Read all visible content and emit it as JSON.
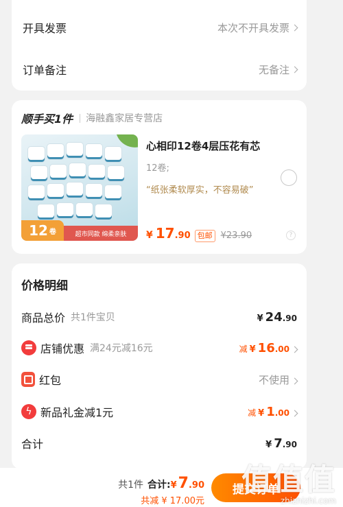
{
  "invoice": {
    "label": "开具发票",
    "value": "本次不开具发票"
  },
  "remark": {
    "label": "订单备注",
    "value": "无备注"
  },
  "addon": {
    "title": "顺手买1件",
    "store": "海融鑫家居专营店",
    "product": {
      "name": "心相印12卷4层压花有芯",
      "spec": "12卷;",
      "quote": "“纸张柔软厚实，不容易破”",
      "price_currency": "¥",
      "price_int": "17",
      "price_dec": ".90",
      "shipping_tag": "包邮",
      "old_price": "¥23.90",
      "image_badge_num": "12",
      "image_badge_unit": "卷",
      "image_caption": "超市同款 绵柔亲肤"
    }
  },
  "price_detail": {
    "title": "价格明细",
    "rows": [
      {
        "label": "商品总价",
        "sub": "共1件宝贝",
        "prefix": "",
        "currency": "¥",
        "int": "24",
        "dec": ".90"
      },
      {
        "label": "店铺优惠",
        "sub": "满24元减16元",
        "prefix": "减",
        "currency": "¥",
        "int": "16",
        "dec": ".00"
      },
      {
        "label": "红包",
        "sub": "",
        "value": "不使用"
      },
      {
        "label": "新品礼金减1元",
        "sub": "",
        "prefix": "减",
        "currency": "¥",
        "int": "1",
        "dec": ".00"
      },
      {
        "label": "合计",
        "sub": "",
        "prefix": "",
        "currency": "¥",
        "int": "7",
        "dec": ".90"
      }
    ]
  },
  "footer": {
    "count": "共1件",
    "total_label": "合计:",
    "total_currency": "¥",
    "total_int": "7",
    "total_dec": ".90",
    "saved": "共减 ¥ 17.00元",
    "submit": "提交订单"
  },
  "watermark": {
    "glyphs": "值值值",
    "url": "zhizhizhi.com"
  },
  "colors": {
    "accent": "#ff5000",
    "background": "#f2f2f2"
  }
}
